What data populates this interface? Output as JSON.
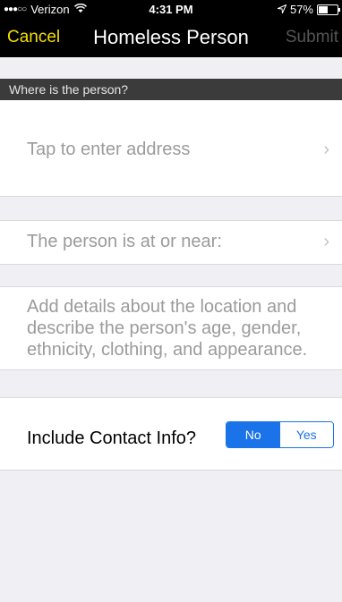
{
  "status_bar": {
    "carrier": "Verizon",
    "time": "4:31 PM",
    "battery": "57%",
    "battery_level": 0.57
  },
  "nav": {
    "cancel": "Cancel",
    "title": "Homeless Person",
    "submit": "Submit"
  },
  "section": {
    "header": "Where is the person?"
  },
  "address": {
    "placeholder": "Tap to enter address"
  },
  "near": {
    "label": "The person is at or near:"
  },
  "details": {
    "placeholder": "Add details about the location and describe the person's age, gender, ethnicity, clothing, and appearance."
  },
  "contact": {
    "label": "Include Contact Info?",
    "options": [
      "No",
      "Yes"
    ],
    "selected": "No"
  },
  "colors": {
    "accent_yellow": "#f6df00",
    "segment_blue": "#1a73e8"
  },
  "icons": {
    "chevron": "chevron-right-icon"
  }
}
